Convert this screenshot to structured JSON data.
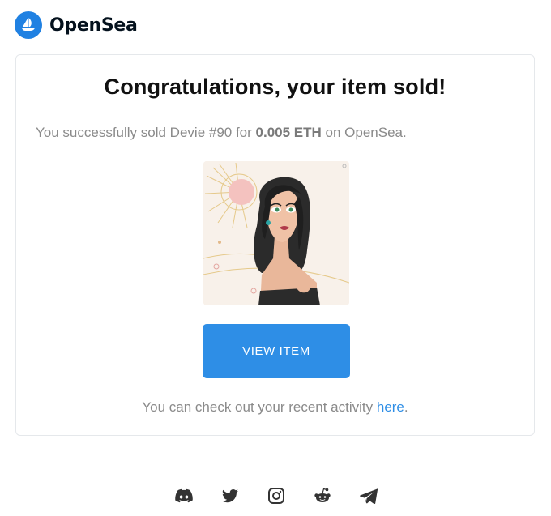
{
  "header": {
    "brand": "OpenSea",
    "logo_icon": "opensea-logo-icon"
  },
  "card": {
    "headline": "Congratulations, your item sold!",
    "sold_prefix": "You successfully sold Devie #90 for ",
    "sold_price": "0.005 ETH",
    "sold_suffix": " on OpenSea.",
    "nft_image_icon": "devie-90-nft-artwork",
    "button_label": "VIEW ITEM",
    "activity_prefix": "You can check out your recent activity ",
    "activity_link": "here",
    "activity_suffix": "."
  },
  "social": [
    {
      "name": "discord-icon"
    },
    {
      "name": "twitter-icon"
    },
    {
      "name": "instagram-icon"
    },
    {
      "name": "reddit-icon"
    },
    {
      "name": "telegram-icon"
    }
  ],
  "colors": {
    "brand_blue": "#2081e2",
    "button_blue": "#2e8ee6",
    "link_blue": "#2e8ee6",
    "text_gray": "#8a8a8a",
    "heading": "#111111"
  }
}
